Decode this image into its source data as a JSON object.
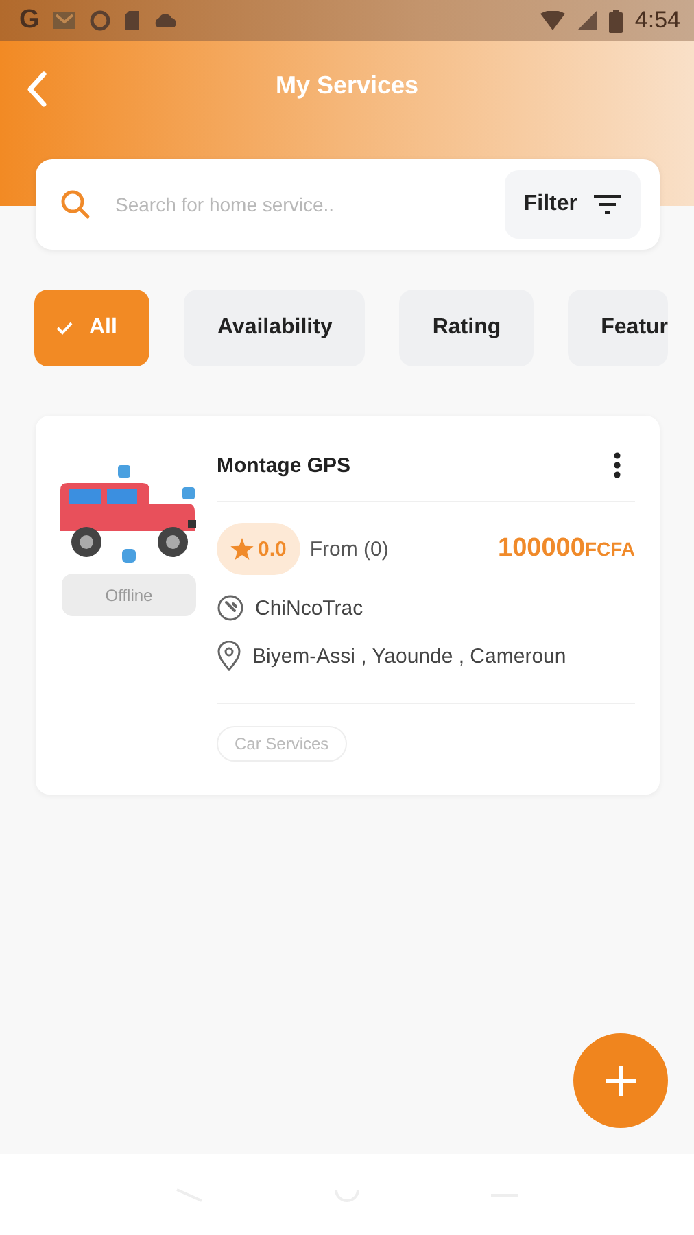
{
  "status_bar": {
    "app_letter": "G",
    "time": "4:54"
  },
  "header": {
    "title": "My Services"
  },
  "search": {
    "placeholder": "Search for home service..",
    "filter_label": "Filter"
  },
  "chips": [
    {
      "label": "All",
      "selected": true
    },
    {
      "label": "Availability",
      "selected": false
    },
    {
      "label": "Rating",
      "selected": false
    },
    {
      "label": "Featur",
      "selected": false
    }
  ],
  "services": [
    {
      "title": "Montage GPS",
      "status": "Offline",
      "rating": "0.0",
      "reviews": "From (0)",
      "price": "100000",
      "currency": "FCFA",
      "provider": "ChiNcoTrac",
      "location": "Biyem-Assi , Yaounde , Cameroun",
      "tag": "Car Services"
    }
  ]
}
